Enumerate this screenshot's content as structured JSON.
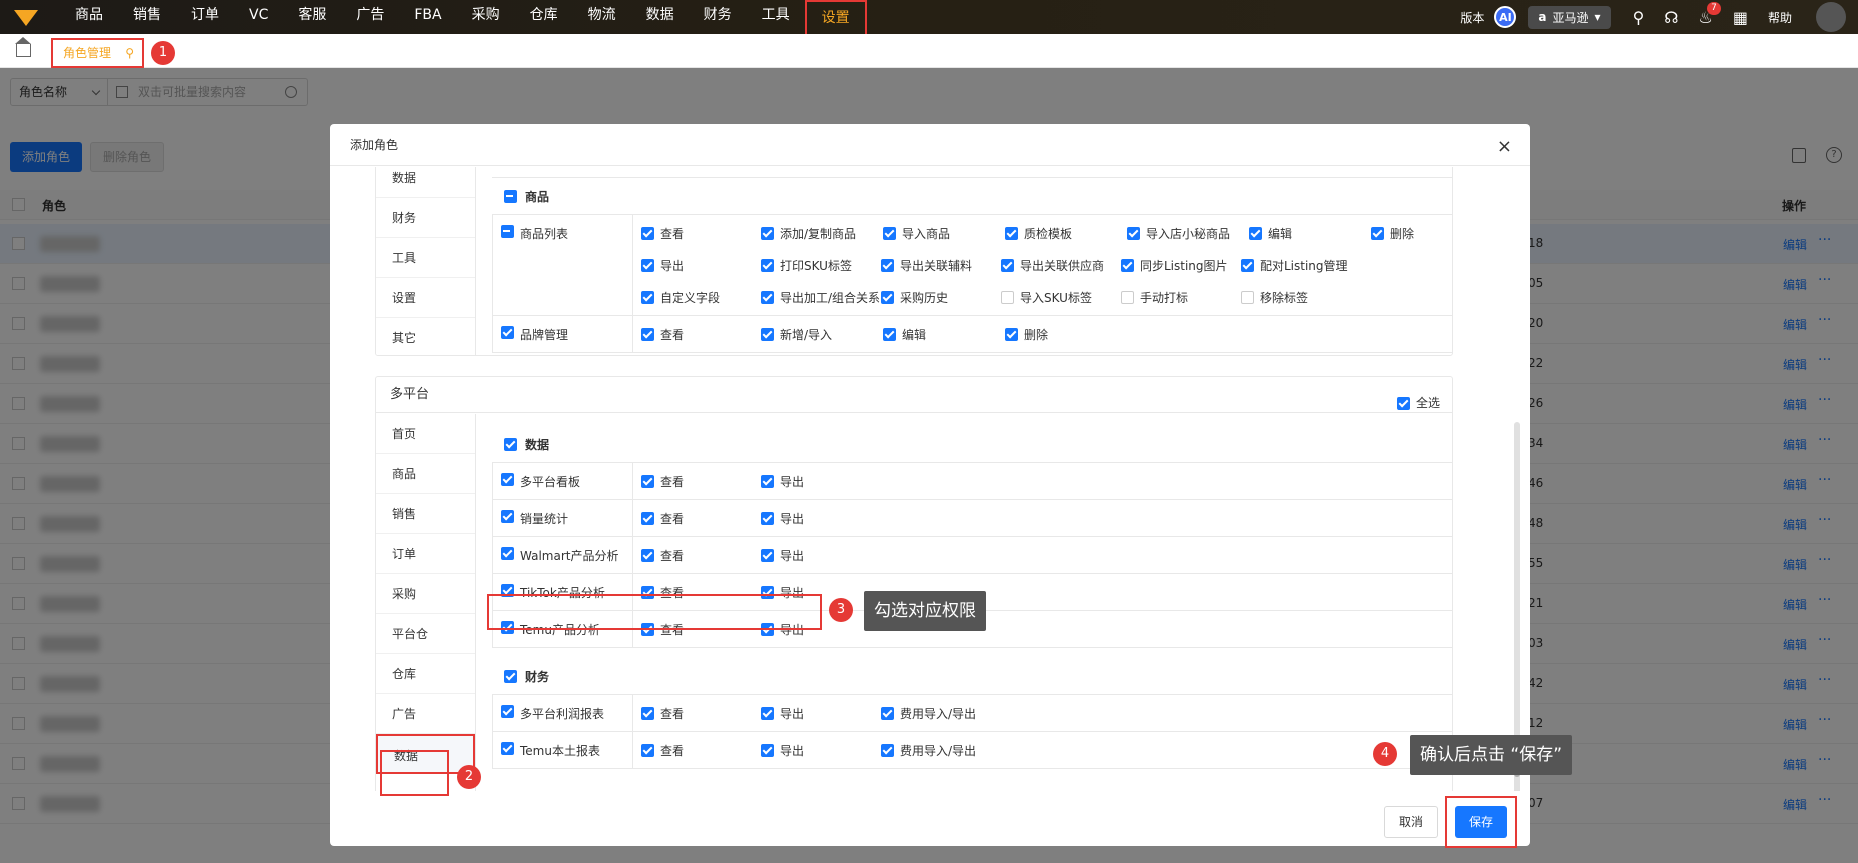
{
  "topbar": {
    "nav": [
      "商品",
      "销售",
      "订单",
      "VC",
      "客服",
      "广告",
      "FBA",
      "采购",
      "仓库",
      "物流",
      "数据",
      "财务",
      "工具",
      "设置"
    ],
    "active_nav": "设置",
    "version_label": "版本",
    "ai_label": "AI",
    "store_label": "亚马逊",
    "notification_count": "7",
    "help_label": "帮助"
  },
  "tabs": {
    "current": "角色管理"
  },
  "filter": {
    "select_label": "角色名称",
    "search_placeholder": "双击可批量搜索内容"
  },
  "actions": {
    "add_role": "添加角色",
    "delete_role": "删除角色"
  },
  "table": {
    "headers": {
      "role": "角色",
      "ops": "操作"
    },
    "rows": [
      "18",
      "05",
      "20",
      "22",
      "26",
      "34",
      "46",
      "48",
      "55",
      "21",
      "03",
      "42",
      "12",
      "",
      "07"
    ],
    "edit_label": "编辑",
    "more_label": "···"
  },
  "modal": {
    "title": "添加角色",
    "close": "×",
    "section1": {
      "side_items": [
        "数据",
        "财务",
        "工具",
        "设置",
        "其它"
      ],
      "group_title": "商品",
      "rows": [
        {
          "label": "商品列表",
          "checked": false,
          "items": [
            {
              "t": "查看",
              "c": true
            },
            {
              "t": "添加/复制商品",
              "c": true
            },
            {
              "t": "导入商品",
              "c": true
            },
            {
              "t": "质检模板",
              "c": true
            },
            {
              "t": "导入店小秘商品",
              "c": true
            },
            {
              "t": "编辑",
              "c": true
            },
            {
              "t": "删除",
              "c": true
            },
            {
              "t": "导出",
              "c": true
            },
            {
              "t": "打印SKU标签",
              "c": true
            },
            {
              "t": "导出关联辅料",
              "c": true
            },
            {
              "t": "导出关联供应商",
              "c": true
            },
            {
              "t": "同步Listing图片",
              "c": true
            },
            {
              "t": "配对Listing管理",
              "c": true
            },
            {
              "t": "自定义字段",
              "c": true
            },
            {
              "t": "导出加工/组合关系",
              "c": true
            },
            {
              "t": "采购历史",
              "c": true
            },
            {
              "t": "导入SKU标签",
              "c": false
            },
            {
              "t": "手动打标",
              "c": false
            },
            {
              "t": "移除标签",
              "c": false
            }
          ]
        },
        {
          "label": "品牌管理",
          "checked": true,
          "items": [
            {
              "t": "查看",
              "c": true
            },
            {
              "t": "新增/导入",
              "c": true
            },
            {
              "t": "编辑",
              "c": true
            },
            {
              "t": "删除",
              "c": true
            }
          ]
        }
      ]
    },
    "section2": {
      "title": "多平台",
      "select_all": "全选",
      "side_items": [
        "首页",
        "商品",
        "销售",
        "订单",
        "采购",
        "平台仓",
        "仓库",
        "广告",
        "数据"
      ],
      "active_side": "数据",
      "group1_title": "数据",
      "group1_rows": [
        {
          "label": "多平台看板",
          "items": [
            "查看",
            "导出"
          ]
        },
        {
          "label": "销量统计",
          "items": [
            "查看",
            "导出"
          ]
        },
        {
          "label": "Walmart产品分析",
          "items": [
            "查看",
            "导出"
          ]
        },
        {
          "label": "TikTok产品分析",
          "items": [
            "查看",
            "导出"
          ]
        },
        {
          "label": "Temu产品分析",
          "items": [
            "查看",
            "导出"
          ]
        }
      ],
      "group2_title": "财务",
      "group2_rows": [
        {
          "label": "多平台利润报表",
          "items": [
            "查看",
            "导出",
            "费用导入/导出"
          ]
        },
        {
          "label": "Temu本土报表",
          "items": [
            "查看",
            "导出",
            "费用导入/导出"
          ]
        }
      ]
    },
    "cancel_label": "取消",
    "save_label": "保存"
  },
  "annotations": {
    "m1": "1",
    "m2": "2",
    "m3": "3",
    "m4": "4",
    "callout3": "勾选对应权限",
    "callout4": "确认后点击 “保存”"
  }
}
